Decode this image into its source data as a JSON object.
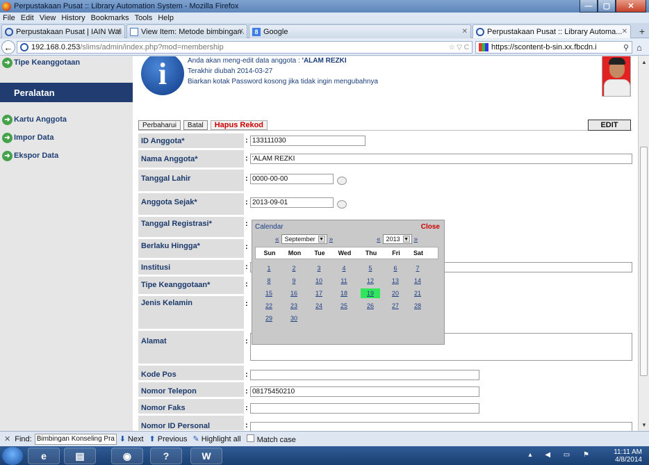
{
  "window": {
    "title": "Perpustakaan Pusat :: Library Automation System - Mozilla Firefox",
    "min": "—",
    "max": "▢",
    "close": "✕"
  },
  "menu": [
    "File",
    "Edit",
    "View",
    "History",
    "Bookmarks",
    "Tools",
    "Help"
  ],
  "tabs": [
    {
      "label": "Perpustakaan Pusat | IAIN Walisongo ...",
      "icon": "site-icon"
    },
    {
      "label": "View Item: Metode bimbingan Agam...",
      "icon": "document-icon"
    },
    {
      "label": "Google",
      "icon": "google-icon",
      "glyph": "8"
    },
    {
      "label": "Perpustakaan Pusat :: Library Automa...",
      "icon": "site-icon"
    }
  ],
  "nav": {
    "url_host": "192.168.0.253",
    "url_path": "/slims/admin/index.php?mod=membership",
    "url_right": "☆ ▽ C",
    "search_text": "https://scontent-b-sin.xx.fbcdn.i",
    "back": "←",
    "home": "⌂",
    "newtab": "+"
  },
  "sidebar": {
    "items_top": [
      "Tipe Keanggotaan"
    ],
    "header": "Peralatan",
    "items": [
      "Kartu Anggota",
      "Impor Data",
      "Ekspor Data"
    ]
  },
  "info": {
    "line1_prefix": "Anda akan meng-edit data anggota : ",
    "line1_name": "'ALAM REZKI",
    "line2": "Terakhir diubah 2014-03-27",
    "line3": "Biarkan kotak Password kosong jika tidak ingin mengubahnya"
  },
  "toolbar": {
    "update": "Perbaharui",
    "cancel": "Batal",
    "delete": "Hapus Rekod",
    "edit": "EDIT"
  },
  "form": {
    "colon": ":",
    "id_label": "ID Anggota*",
    "id_value": "133111030",
    "name_label": "Nama Anggota*",
    "name_value": "'ALAM REZKI",
    "dob_label": "Tanggal Lahir",
    "dob_value": "0000-00-00",
    "since_label": "Anggota Sejak*",
    "since_value": "2013-09-01",
    "reg_label": "Tanggal Registrasi*",
    "expire_label": "Berlaku Hingga*",
    "inst_label": "Institusi",
    "type_label": "Tipe Keanggotaan*",
    "gender_label": "Jenis Kelamin",
    "address_label": "Alamat",
    "zip_label": "Kode Pos",
    "phone_label": "Nomor Telepon",
    "phone_value": "08175450210",
    "fax_label": "Nomor Faks",
    "pid_label": "Nomor ID Personal"
  },
  "calendar": {
    "title": "Calendar",
    "close": "Close",
    "prev": "«",
    "next": "»",
    "month": "September",
    "year": "2013",
    "dow": [
      "Sun",
      "Mon",
      "Tue",
      "Wed",
      "Thu",
      "Fri",
      "Sat"
    ],
    "weeks": [
      [
        "1",
        "2",
        "3",
        "4",
        "5",
        "6",
        "7"
      ],
      [
        "8",
        "9",
        "10",
        "11",
        "12",
        "13",
        "14"
      ],
      [
        "15",
        "16",
        "17",
        "18",
        "19",
        "20",
        "21"
      ],
      [
        "22",
        "23",
        "24",
        "25",
        "26",
        "27",
        "28"
      ],
      [
        "29",
        "30",
        "",
        "",
        "",
        "",
        ""
      ]
    ],
    "selected": "19",
    "highlight_color": "#32e65c"
  },
  "findbar": {
    "close": "✕",
    "label": "Find:",
    "value": "Bimbingan Konseling Pra I",
    "next": "Next",
    "previous": "Previous",
    "highlight": "Highlight all",
    "matchcase": "Match case"
  },
  "taskbar": {
    "time": "11:11 AM",
    "date": "4/8/2014",
    "apps": [
      "e",
      "▤",
      "◉",
      "?",
      "W"
    ]
  }
}
